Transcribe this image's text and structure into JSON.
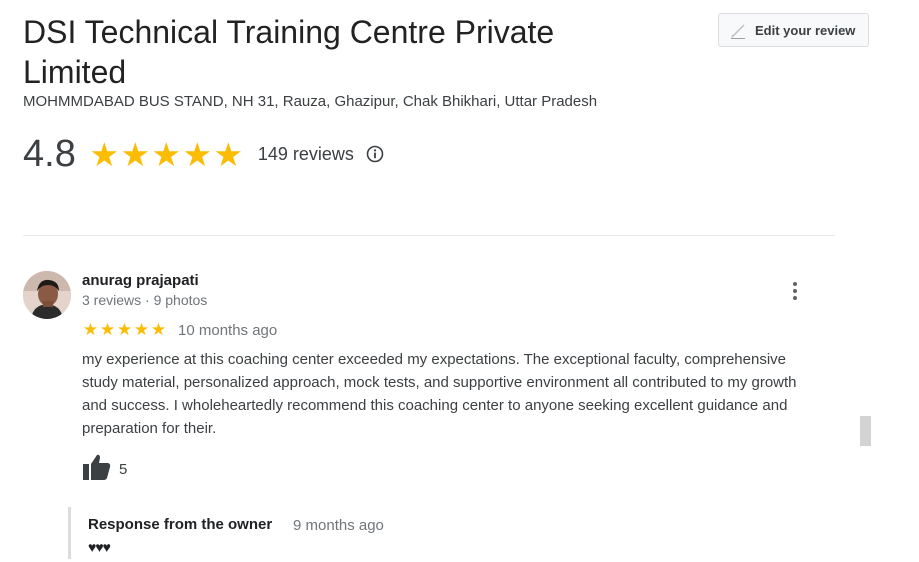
{
  "business": {
    "name": "DSI Technical Training Centre Private Limited",
    "address": "MOHMMDABAD BUS STAND, NH 31, Rauza, Ghazipur, Chak Bhikhari, Uttar Pradesh",
    "rating": "4.8",
    "stars": 5,
    "review_count": "149 reviews",
    "edit_review_label": "Edit your review"
  },
  "review": {
    "author": "anurag prajapati",
    "meta": "3 reviews · 9 photos",
    "rating": 5,
    "time": "10 months ago",
    "text": "my experience at this coaching center exceeded my expectations. The exceptional faculty, comprehensive study material, personalized approach, mock tests, and supportive environment all contributed to my growth and success. I wholeheartedly recommend this coaching center to anyone seeking excellent guidance and preparation for their.",
    "likes": "5"
  },
  "owner_response": {
    "title": "Response from the owner",
    "time": "9 months ago",
    "text": "♥♥♥"
  },
  "colors": {
    "star": "#fbbc04",
    "text_primary": "#202124",
    "text_secondary": "#70757a",
    "divider": "#e8eaed"
  },
  "icons": [
    "pencil-icon",
    "star-icon",
    "info-icon",
    "more-vert-icon",
    "thumb-up-icon"
  ]
}
